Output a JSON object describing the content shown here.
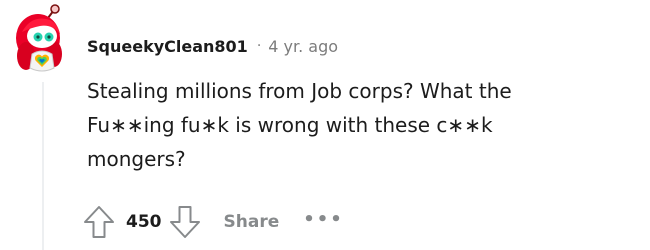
{
  "comment": {
    "username": "SqueekyClean801",
    "separator": "·",
    "timestamp": "4 yr. ago",
    "body_lines": [
      "Stealing millions from Job corps? What the",
      "Fu∗∗ing fu∗k is wrong with these c∗∗k",
      "mongers?"
    ],
    "score": "450",
    "share_label": "Share",
    "more_label": "•••",
    "avatar_icon": "snoo-avatar-icon",
    "upvote_icon": "upvote-arrow-icon",
    "downvote_icon": "downvote-arrow-icon"
  },
  "colors": {
    "text": "#1c1c1c",
    "meta": "#7c7c7c",
    "action": "#878a8c",
    "avatar_hair": "#ea0027",
    "thread_line": "#edeff1"
  }
}
